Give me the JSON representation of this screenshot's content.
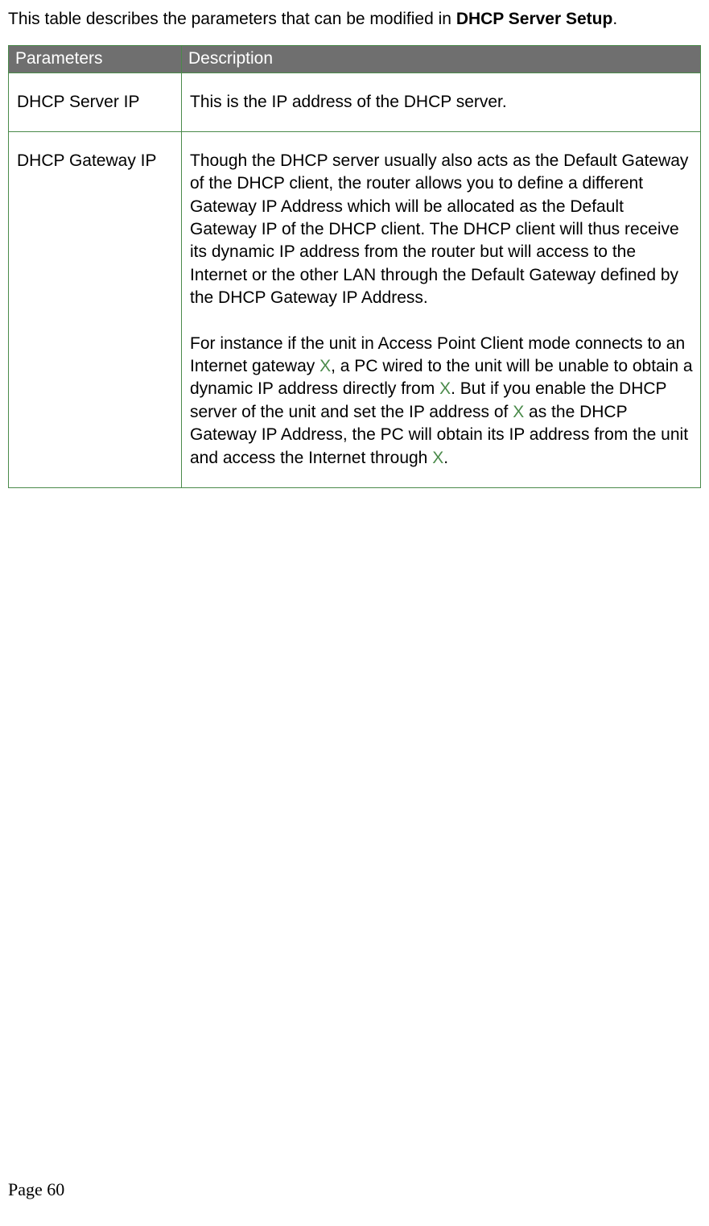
{
  "intro": {
    "prefix": "This table describes the parameters that can be modified in ",
    "strong": "DHCP Server Setup",
    "suffix": "."
  },
  "table": {
    "headers": {
      "param": "Parameters",
      "desc": "Description"
    },
    "rows": [
      {
        "param": "DHCP Server IP",
        "desc_plain": "This is the IP address of the DHCP server."
      },
      {
        "param": "DHCP Gateway IP",
        "para1": "Though the DHCP server usually also acts as the Default Gateway of the DHCP client, the router allows you to define a different Gateway IP Address which will be allocated as the Default Gateway IP of the DHCP client. The DHCP client will thus receive its dynamic IP address from the router but will access to the Internet or the other LAN through the Default Gateway defined by the DHCP Gateway IP Address.",
        "para2": {
          "t1": "For instance if the unit in Access Point Client mode connects to an Internet gateway ",
          "x1": "X",
          "t2": ", a PC wired to the unit will be unable to obtain a dynamic IP address directly from ",
          "x2": "X",
          "t3": ".   But if you enable the DHCP server of the unit and set the IP address of ",
          "x3": "X",
          "t4": " as the DHCP Gateway IP Address, the PC will obtain its IP address from the unit and access the Internet through ",
          "x4": "X",
          "t5": "."
        }
      }
    ]
  },
  "footer": {
    "label": "Page 60"
  }
}
